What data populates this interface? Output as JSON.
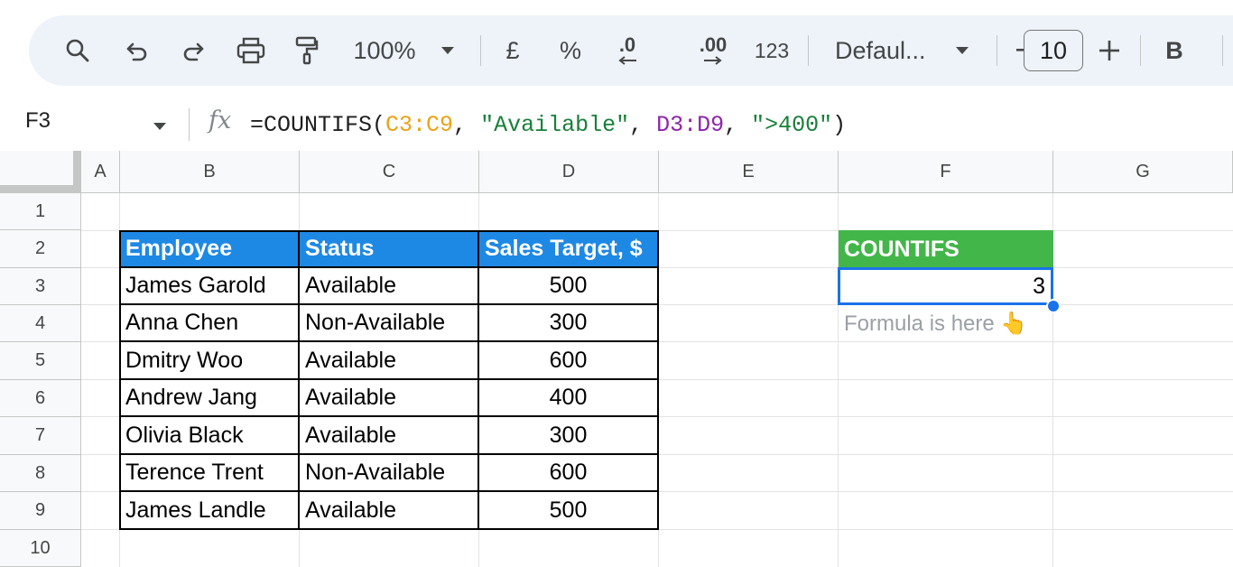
{
  "toolbar": {
    "zoom": "100%",
    "currency": "£",
    "percent": "%",
    "decrease_decimal": ".0",
    "increase_decimal": ".00",
    "number_format": "123",
    "font": "Defaul...",
    "font_size": "10",
    "bold": "B"
  },
  "formula_bar": {
    "cell_ref": "F3",
    "fx": "fx",
    "formula_prefix": "=COUNTIFS(",
    "range1": "C3:C9",
    "sep1": ", ",
    "criteria1": "\"Available\"",
    "sep2": ", ",
    "range2": "D3:D9",
    "sep3": ", ",
    "criteria2": "\">400\"",
    "formula_suffix": ")"
  },
  "columns": [
    "A",
    "B",
    "C",
    "D",
    "E",
    "F",
    "G"
  ],
  "rows": [
    "1",
    "2",
    "3",
    "4",
    "5",
    "6",
    "7",
    "8",
    "9",
    "10"
  ],
  "table": {
    "headers": [
      "Employee",
      "Status",
      "Sales Target, $"
    ],
    "rows": [
      [
        "James Garold",
        "Available",
        "500"
      ],
      [
        "Anna Chen",
        "Non-Available",
        "300"
      ],
      [
        "Dmitry Woo",
        "Available",
        "600"
      ],
      [
        "Andrew Jang",
        "Available",
        "400"
      ],
      [
        "Olivia Black",
        "Available",
        "300"
      ],
      [
        "Terence Trent",
        "Non-Available",
        "600"
      ],
      [
        "James Landle",
        "Available",
        "500"
      ]
    ]
  },
  "result": {
    "header": "COUNTIFS",
    "value": "3",
    "note": "Formula is here 👆"
  },
  "colors": {
    "header_blue": "#1e88e5",
    "header_green": "#43b649",
    "selection": "#1a73e8"
  }
}
